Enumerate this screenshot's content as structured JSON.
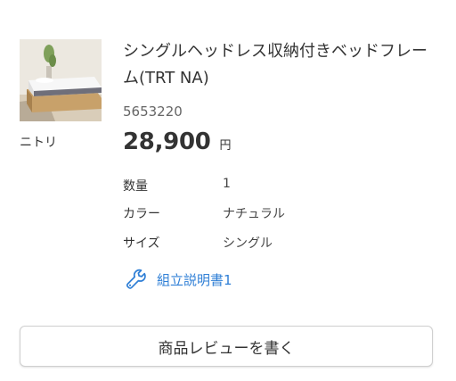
{
  "product": {
    "title": "シングルヘッドレス収納付きベッドフレーム(TRT NA)",
    "brand": "ニトリ",
    "code": "5653220",
    "price": "28,900",
    "price_unit": "円",
    "image_icon": "bed-product-photo"
  },
  "specs": [
    {
      "label": "数量",
      "value": "1"
    },
    {
      "label": "カラー",
      "value": "ナチュラル"
    },
    {
      "label": "サイズ",
      "value": "シングル"
    }
  ],
  "manual": {
    "label": "組立説明書1",
    "icon": "wrench-icon",
    "color": "#2f7fd6"
  },
  "review_button": {
    "label": "商品レビューを書く"
  }
}
